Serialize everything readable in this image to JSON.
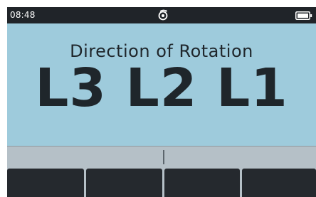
{
  "status_bar": {
    "time": "08:48",
    "center_icon": "rotation-indicator-icon",
    "right_icon": "battery-icon",
    "colors": {
      "background": "#202429",
      "foreground": "#ffffff"
    }
  },
  "display": {
    "title": "Direction of Rotation",
    "phase_sequence": "L3 L2 L1",
    "colors": {
      "background": "#9ecbdc",
      "text": "#1f262b"
    }
  },
  "softkeys": [
    {
      "label": ""
    },
    {
      "label": ""
    },
    {
      "label": ""
    },
    {
      "label": ""
    }
  ],
  "softkey_label_bar": {
    "color": "#b5c0c7"
  }
}
